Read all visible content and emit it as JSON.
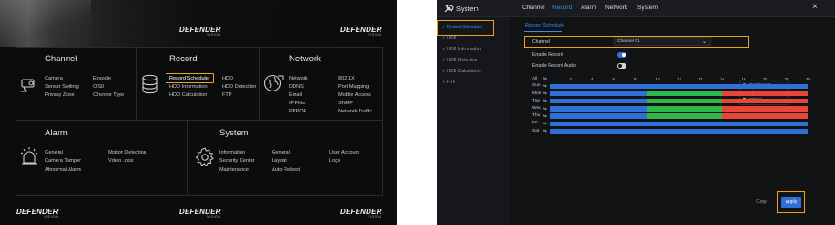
{
  "main_menu": {
    "logo": {
      "brand": "DEFENDER",
      "sub": "VISION"
    },
    "channel": {
      "title": "Channel",
      "items": [
        "Camera",
        "Sensor Setting",
        "Privacy Zone",
        "Encode",
        "OSD",
        "Channel Type"
      ]
    },
    "record": {
      "title": "Record",
      "items": [
        "Record Schedule",
        "HDD Information",
        "HDD Calculation",
        "HDD",
        "HDD Detection",
        "FTP"
      ]
    },
    "network": {
      "title": "Network",
      "items": [
        "Network",
        "DDNS",
        "Email",
        "IP Filter",
        "PPPOE",
        "802.1X",
        "Port Mapping",
        "Mobile Access",
        "SNMP",
        "Network Traffic"
      ]
    },
    "alarm": {
      "title": "Alarm",
      "items": [
        "General",
        "Camera Tamper",
        "Abnormal Alarm",
        "Motion Detection",
        "Video Loss"
      ]
    },
    "system": {
      "title": "System",
      "items": [
        "Information",
        "Security Center",
        "Maintenance",
        "General",
        "Layout",
        "Auto Reboot",
        "User Account",
        "Logs"
      ]
    },
    "highlight_color": "#f0a31a"
  },
  "record_settings": {
    "window_title": "System",
    "tabs": [
      "Channel",
      "Record",
      "Alarm",
      "Network",
      "System"
    ],
    "active_tab": "Record",
    "close_symbol": "×",
    "sidebar": [
      {
        "label": "Record Schedule",
        "active": true
      },
      {
        "label": "HDD"
      },
      {
        "label": "HDD Information"
      },
      {
        "label": "HDD Detection"
      },
      {
        "label": "HDD Calculation"
      },
      {
        "label": "FTP"
      }
    ],
    "subtab": "Record Schedule",
    "channel_label": "Channel",
    "channel_value": "Channel 01",
    "enable_record_label": "Enable Record",
    "enable_record_audio_label": "Enable Record Audio",
    "all_label": "All",
    "hours": [
      "2",
      "4",
      "6",
      "8",
      "10",
      "12",
      "14",
      "16",
      "18",
      "20",
      "22",
      "24"
    ],
    "days": [
      "Sun",
      "Mon",
      "Tue",
      "Wed",
      "Thu",
      "Fri",
      "Sat"
    ],
    "legend": [
      {
        "label": "Continuous",
        "color": "#2f6fd8"
      },
      {
        "label": "Alarm",
        "color": "#e84438"
      },
      {
        "label": "Motion",
        "color": "#f0a31a"
      }
    ],
    "copy_label": "Copy",
    "apply_label": "Apply",
    "colors": {
      "continuous": "#2f6fd8",
      "motion": "#2eb84a",
      "alarm": "#e84438",
      "accent": "#3d8cf2"
    },
    "schedule": [
      {
        "day": "Sun",
        "segments": [
          {
            "type": "continuous",
            "from": 0,
            "to": 24
          }
        ]
      },
      {
        "day": "Mon",
        "segments": [
          {
            "type": "continuous",
            "from": 0,
            "to": 9
          },
          {
            "type": "motion",
            "from": 9,
            "to": 16
          },
          {
            "type": "alarm",
            "from": 16,
            "to": 24
          }
        ]
      },
      {
        "day": "Tue",
        "segments": [
          {
            "type": "continuous",
            "from": 0,
            "to": 9
          },
          {
            "type": "motion",
            "from": 9,
            "to": 16
          },
          {
            "type": "alarm",
            "from": 16,
            "to": 24
          }
        ]
      },
      {
        "day": "Wed",
        "segments": [
          {
            "type": "continuous",
            "from": 0,
            "to": 9
          },
          {
            "type": "motion",
            "from": 9,
            "to": 16
          },
          {
            "type": "alarm",
            "from": 16,
            "to": 24
          }
        ]
      },
      {
        "day": "Thu",
        "segments": [
          {
            "type": "continuous",
            "from": 0,
            "to": 9
          },
          {
            "type": "motion",
            "from": 9,
            "to": 16
          },
          {
            "type": "alarm",
            "from": 16,
            "to": 24
          }
        ]
      },
      {
        "day": "Fri",
        "segments": [
          {
            "type": "continuous",
            "from": 0,
            "to": 24
          }
        ]
      },
      {
        "day": "Sat",
        "segments": [
          {
            "type": "continuous",
            "from": 0,
            "to": 24
          }
        ]
      }
    ]
  }
}
